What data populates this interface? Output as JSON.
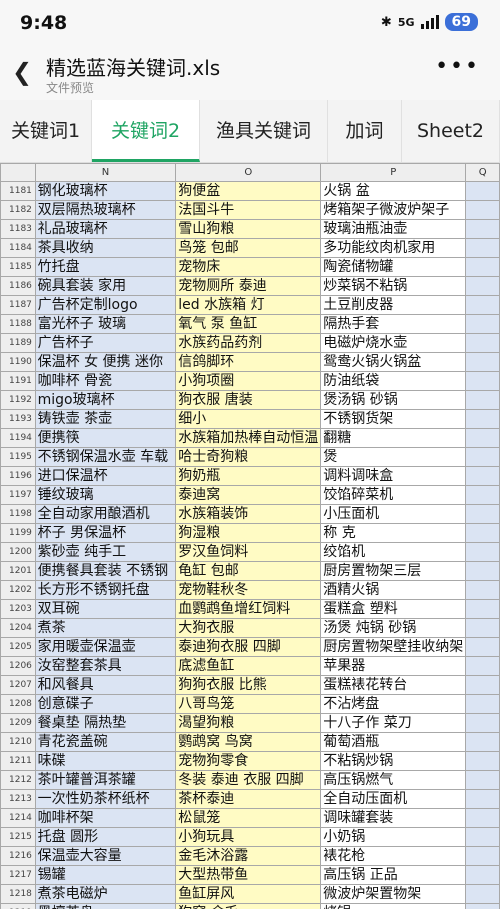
{
  "status_bar": {
    "time": "9:48",
    "network": "5G",
    "battery": "69"
  },
  "header": {
    "file_title": "精选蓝海关键词.xls",
    "subtitle": "文件预览",
    "back_icon": "chevron-left-icon",
    "more_icon": "more-dots-icon"
  },
  "tabs": [
    {
      "label": "关键词1",
      "active": false
    },
    {
      "label": "关键词2",
      "active": true
    },
    {
      "label": "渔具关键词",
      "active": false
    },
    {
      "label": "加词",
      "active": false
    },
    {
      "label": "Sheet2",
      "active": false
    }
  ],
  "grid": {
    "columns": [
      "N",
      "O",
      "P",
      "Q"
    ],
    "rows": [
      {
        "num": "1181",
        "n": "钢化玻璃杯",
        "o": "狗便盆",
        "p": "火锅 盆"
      },
      {
        "num": "1182",
        "n": "双层隔热玻璃杯",
        "o": "法国斗牛",
        "p": "烤箱架子微波炉架子"
      },
      {
        "num": "1183",
        "n": "礼品玻璃杯",
        "o": "雪山狗粮",
        "p": "玻璃油瓶油壶"
      },
      {
        "num": "1184",
        "n": "茶具收纳",
        "o": "鸟笼 包邮",
        "p": "多功能纹肉机家用"
      },
      {
        "num": "1185",
        "n": "竹托盘",
        "o": "宠物床",
        "p": "陶瓷储物罐"
      },
      {
        "num": "1186",
        "n": "碗具套装 家用",
        "o": "宠物厕所 泰迪",
        "p": "炒菜锅不粘锅"
      },
      {
        "num": "1187",
        "n": "广告杯定制logo",
        "o": "led 水族箱 灯",
        "p": "土豆削皮器"
      },
      {
        "num": "1188",
        "n": "富光杯子 玻璃",
        "o": "氧气 泵 鱼缸",
        "p": "隔热手套"
      },
      {
        "num": "1189",
        "n": "广告杯子",
        "o": "水族药品药剂",
        "p": "电磁炉烧水壶"
      },
      {
        "num": "1190",
        "n": "保温杯 女 便携 迷你",
        "o": "信鸽脚环",
        "p": "鸳鸯火锅火锅盆"
      },
      {
        "num": "1191",
        "n": "咖啡杯 骨瓷",
        "o": "小狗项圈",
        "p": "防油纸袋"
      },
      {
        "num": "1192",
        "n": "migo玻璃杯",
        "o": "狗衣服 唐装",
        "p": "煲汤锅 砂锅"
      },
      {
        "num": "1193",
        "n": "铸铁壶 茶壶",
        "o": "细小",
        "p": "不锈钢货架"
      },
      {
        "num": "1194",
        "n": "便携筷",
        "o": "水族箱加热棒自动恒温",
        "p": "翻糖"
      },
      {
        "num": "1195",
        "n": "不锈钢保温水壶 车载",
        "o": "哈士奇狗粮",
        "p": "煲"
      },
      {
        "num": "1196",
        "n": "进口保温杯",
        "o": "狗奶瓶",
        "p": "调料调味盒"
      },
      {
        "num": "1197",
        "n": "锤纹玻璃",
        "o": "泰迪窝",
        "p": "饺馅碎菜机"
      },
      {
        "num": "1198",
        "n": "全自动家用酿酒机",
        "o": "水族箱装饰",
        "p": "小压面机"
      },
      {
        "num": "1199",
        "n": "杯子 男保温杯",
        "o": "狗湿粮",
        "p": "称 克"
      },
      {
        "num": "1200",
        "n": "紫砂壶 纯手工",
        "o": "罗汉鱼饲料",
        "p": "绞馅机"
      },
      {
        "num": "1201",
        "n": "便携餐具套装 不锈钢",
        "o": "龟缸 包邮",
        "p": "厨房置物架三层"
      },
      {
        "num": "1202",
        "n": "长方形不锈钢托盘",
        "o": "宠物鞋秋冬",
        "p": "酒精火锅"
      },
      {
        "num": "1203",
        "n": "双耳碗",
        "o": "血鹦鹉鱼增红饲料",
        "p": "蛋糕盒 塑料"
      },
      {
        "num": "1204",
        "n": "煮茶",
        "o": "大狗衣服",
        "p": "汤煲 炖锅 砂锅"
      },
      {
        "num": "1205",
        "n": "家用暖壶保温壶",
        "o": "泰迪狗衣服 四脚",
        "p": "厨房置物架壁挂收纳架"
      },
      {
        "num": "1206",
        "n": "汝窑整套茶具",
        "o": "底滤鱼缸",
        "p": "苹果器"
      },
      {
        "num": "1207",
        "n": "和风餐具",
        "o": "狗狗衣服 比熊",
        "p": "蛋糕裱花转台"
      },
      {
        "num": "1208",
        "n": "创意碟子",
        "o": "八哥鸟笼",
        "p": "不沾烤盘"
      },
      {
        "num": "1209",
        "n": "餐桌垫 隔热垫",
        "o": "渴望狗粮",
        "p": "十八子作 菜刀"
      },
      {
        "num": "1210",
        "n": "青花瓷盖碗",
        "o": "鹦鹉窝 鸟窝",
        "p": "葡萄酒瓶"
      },
      {
        "num": "1211",
        "n": "味碟",
        "o": "宠物狗零食",
        "p": "不粘锅炒锅"
      },
      {
        "num": "1212",
        "n": "茶叶罐普洱茶罐",
        "o": "冬装 泰迪 衣服 四脚",
        "p": "高压锅燃气"
      },
      {
        "num": "1213",
        "n": "一次性奶茶杯纸杯",
        "o": "茶杯泰迪",
        "p": "全自动压面机"
      },
      {
        "num": "1214",
        "n": "咖啡杯架",
        "o": "松鼠笼",
        "p": "调味罐套装"
      },
      {
        "num": "1215",
        "n": "托盘 圆形",
        "o": "小狗玩具",
        "p": "小奶锅"
      },
      {
        "num": "1216",
        "n": "保温壶大容量",
        "o": "金毛沐浴露",
        "p": "裱花枪"
      },
      {
        "num": "1217",
        "n": "锡罐",
        "o": "大型热带鱼",
        "p": "高压锅 正品"
      },
      {
        "num": "1218",
        "n": "煮茶电磁炉",
        "o": "鱼缸屏风",
        "p": "微波炉架置物架"
      },
      {
        "num": "1219",
        "n": "黑檀茶盘",
        "o": "狗窝 金毛",
        "p": "烤锅"
      }
    ]
  }
}
